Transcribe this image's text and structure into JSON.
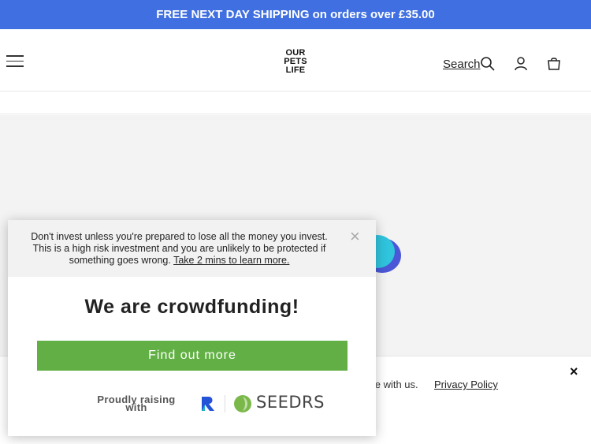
{
  "announcement": {
    "text": "FREE NEXT DAY SHIPPING on orders over £35.00"
  },
  "header": {
    "logo_lines": [
      "OUR",
      "PETS",
      "LIFE"
    ],
    "search_label": "Search",
    "icons": [
      "menu-icon",
      "search-icon",
      "account-icon",
      "cart-icon"
    ]
  },
  "consent_bar": {
    "text": "nce with us.",
    "link": "Privacy Policy",
    "close": "×"
  },
  "modal": {
    "disclaimer_text": "Don't invest unless you're prepared to lose all the money you invest. This is a high risk investment and you are unlikely to be protected if something goes wrong.",
    "disclaimer_link": "Take 2 mins to learn more.",
    "close": "×",
    "title": "We are crowdfunding!",
    "cta": "Find out more",
    "raising_text": "Proudly raising with",
    "partner": "SEEDRS"
  },
  "colors": {
    "announcement_bg": "#3f6fe0",
    "cta_bg": "#62b045",
    "seedrs_green": "#7bb84a",
    "rep_blue": "#2453d8"
  }
}
